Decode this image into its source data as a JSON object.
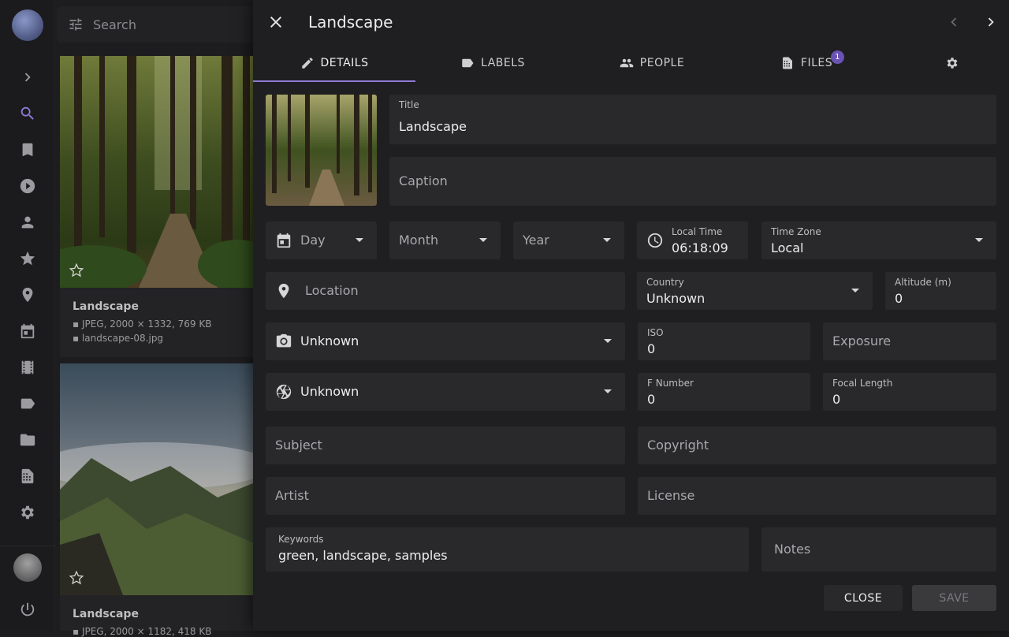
{
  "search": {
    "placeholder": "Search"
  },
  "cards": [
    {
      "title": "Landscape",
      "info": "JPEG, 2000 × 1332, 769 KB",
      "file": "landscape-08.jpg"
    },
    {
      "title": "Landscape",
      "info": "JPEG, 2000 × 1182, 418 KB"
    }
  ],
  "dialog": {
    "title": "Landscape",
    "tabs": [
      {
        "label": "DETAILS",
        "icon": "pencil-icon"
      },
      {
        "label": "LABELS",
        "icon": "label-icon"
      },
      {
        "label": "PEOPLE",
        "icon": "people-icon"
      },
      {
        "label": "FILES",
        "icon": "files-icon",
        "badge": "1"
      }
    ],
    "fields": {
      "title": {
        "label": "Title",
        "value": "Landscape"
      },
      "caption": {
        "placeholder": "Caption"
      },
      "day": {
        "value": "Day"
      },
      "month": {
        "value": "Month"
      },
      "year": {
        "value": "Year"
      },
      "local_time": {
        "label": "Local Time",
        "value": "06:18:09"
      },
      "time_zone": {
        "label": "Time Zone",
        "value": "Local"
      },
      "location": {
        "placeholder": "Location"
      },
      "country": {
        "label": "Country",
        "value": "Unknown"
      },
      "altitude": {
        "label": "Altitude (m)",
        "value": "0"
      },
      "camera": {
        "value": "Unknown"
      },
      "iso": {
        "label": "ISO",
        "value": "0"
      },
      "exposure": {
        "placeholder": "Exposure"
      },
      "lens": {
        "value": "Unknown"
      },
      "f_number": {
        "label": "F Number",
        "value": "0"
      },
      "focal_length": {
        "label": "Focal Length",
        "value": "0"
      },
      "subject": {
        "placeholder": "Subject"
      },
      "copyright": {
        "placeholder": "Copyright"
      },
      "artist": {
        "placeholder": "Artist"
      },
      "license": {
        "placeholder": "License"
      },
      "keywords": {
        "label": "Keywords",
        "value": "green, landscape, samples"
      },
      "notes": {
        "placeholder": "Notes"
      }
    },
    "buttons": {
      "close": "CLOSE",
      "save": "SAVE"
    }
  },
  "colors": {
    "accent": "#8f7bd6",
    "background": "#1d1d1f",
    "field": "#29292b"
  }
}
